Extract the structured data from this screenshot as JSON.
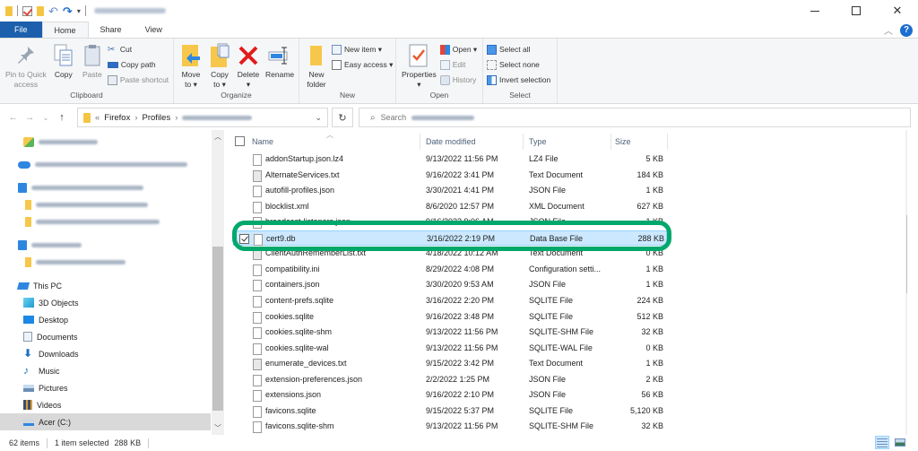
{
  "window": {
    "title_redacted": true,
    "controls": {
      "minimize": "minimize-icon",
      "maximize": "maximize-icon",
      "close": "close-icon"
    }
  },
  "tabs": [
    {
      "label": "File"
    },
    {
      "label": "Home"
    },
    {
      "label": "Share"
    },
    {
      "label": "View"
    }
  ],
  "ribbon": {
    "clipboard": {
      "label": "Clipboard",
      "pin": "Pin to Quick access",
      "pin_line1": "Pin to Quick",
      "pin_line2": "access",
      "copy": "Copy",
      "paste": "Paste",
      "cut": "Cut",
      "copy_path": "Copy path",
      "paste_shortcut": "Paste shortcut"
    },
    "organize": {
      "label": "Organize",
      "move_line1": "Move",
      "move_line2": "to ▾",
      "copy_line1": "Copy",
      "copy_line2": "to ▾",
      "delete": "Delete",
      "delete_caret": "▾",
      "rename": "Rename"
    },
    "new": {
      "label": "New",
      "new_folder_line1": "New",
      "new_folder_line2": "folder",
      "new_item": "New item ▾",
      "easy_access": "Easy access ▾"
    },
    "open": {
      "label": "Open",
      "properties": "Properties",
      "properties_caret": "▾",
      "open": "Open ▾",
      "edit": "Edit",
      "history": "History"
    },
    "select": {
      "label": "Select",
      "select_all": "Select all",
      "select_none": "Select none",
      "invert": "Invert selection"
    }
  },
  "address": {
    "overflow": "«",
    "crumbs": [
      "Firefox",
      "Profiles"
    ],
    "separator": "›",
    "search_label": "Search"
  },
  "nav": {
    "this_pc": "This PC",
    "items": [
      {
        "label": "3D Objects",
        "icon": "3d-objects-icon"
      },
      {
        "label": "Desktop",
        "icon": "desktop-icon"
      },
      {
        "label": "Documents",
        "icon": "documents-icon"
      },
      {
        "label": "Downloads",
        "icon": "downloads-icon"
      },
      {
        "label": "Music",
        "icon": "music-icon"
      },
      {
        "label": "Pictures",
        "icon": "pictures-icon"
      },
      {
        "label": "Videos",
        "icon": "videos-icon"
      },
      {
        "label": "Acer (C:)",
        "icon": "drive-icon"
      }
    ]
  },
  "columns": {
    "name": "Name",
    "date": "Date modified",
    "type": "Type",
    "size": "Size"
  },
  "files": [
    {
      "name": "addonStartup.json.lz4",
      "date": "9/13/2022 11:56 PM",
      "type": "LZ4 File",
      "size": "5 KB",
      "icon": "file"
    },
    {
      "name": "AlternateServices.txt",
      "date": "9/16/2022 3:41 PM",
      "type": "Text Document",
      "size": "184 KB",
      "icon": "txt"
    },
    {
      "name": "autofill-profiles.json",
      "date": "3/30/2021 4:41 PM",
      "type": "JSON File",
      "size": "1 KB",
      "icon": "file"
    },
    {
      "name": "blocklist.xml",
      "date": "8/6/2020 12:57 PM",
      "type": "XML Document",
      "size": "627 KB",
      "icon": "file"
    },
    {
      "name": "broadcast-listeners.json",
      "date": "9/16/2022 9:06 AM",
      "type": "JSON File",
      "size": "1 KB",
      "icon": "file"
    },
    {
      "name": "cert9.db",
      "date": "3/16/2022 2:19 PM",
      "type": "Data Base File",
      "size": "288 KB",
      "icon": "db",
      "selected": true
    },
    {
      "name": "ClientAuthRememberList.txt",
      "date": "4/18/2022 10:12 AM",
      "type": "Text Document",
      "size": "0 KB",
      "icon": "txt"
    },
    {
      "name": "compatibility.ini",
      "date": "8/29/2022 4:08 PM",
      "type": "Configuration setti...",
      "size": "1 KB",
      "icon": "ini"
    },
    {
      "name": "containers.json",
      "date": "3/30/2020 9:53 AM",
      "type": "JSON File",
      "size": "1 KB",
      "icon": "file"
    },
    {
      "name": "content-prefs.sqlite",
      "date": "3/16/2022 2:20 PM",
      "type": "SQLITE File",
      "size": "224 KB",
      "icon": "file"
    },
    {
      "name": "cookies.sqlite",
      "date": "9/16/2022 3:48 PM",
      "type": "SQLITE File",
      "size": "512 KB",
      "icon": "file"
    },
    {
      "name": "cookies.sqlite-shm",
      "date": "9/13/2022 11:56 PM",
      "type": "SQLITE-SHM File",
      "size": "32 KB",
      "icon": "file"
    },
    {
      "name": "cookies.sqlite-wal",
      "date": "9/13/2022 11:56 PM",
      "type": "SQLITE-WAL File",
      "size": "0 KB",
      "icon": "file"
    },
    {
      "name": "enumerate_devices.txt",
      "date": "9/15/2022 3:42 PM",
      "type": "Text Document",
      "size": "1 KB",
      "icon": "txt"
    },
    {
      "name": "extension-preferences.json",
      "date": "2/2/2022 1:25 PM",
      "type": "JSON File",
      "size": "2 KB",
      "icon": "file"
    },
    {
      "name": "extensions.json",
      "date": "9/16/2022 2:10 PM",
      "type": "JSON File",
      "size": "56 KB",
      "icon": "file"
    },
    {
      "name": "favicons.sqlite",
      "date": "9/15/2022 5:37 PM",
      "type": "SQLITE File",
      "size": "5,120 KB",
      "icon": "file"
    },
    {
      "name": "favicons.sqlite-shm",
      "date": "9/13/2022 11:56 PM",
      "type": "SQLITE-SHM File",
      "size": "32 KB",
      "icon": "file"
    }
  ],
  "status": {
    "count": "62 items",
    "selection": "1 item selected",
    "selection_size": "288 KB"
  },
  "colors": {
    "file_tab": "#1c5fad",
    "selection_bg": "#cce8ff",
    "highlight_outline": "#00a86b"
  }
}
